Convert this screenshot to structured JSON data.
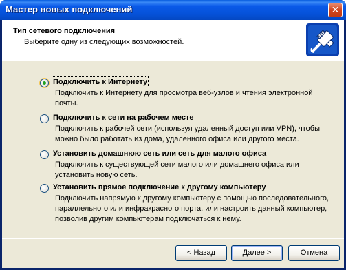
{
  "window": {
    "title": "Мастер новых подключений",
    "close_glyph": "✕"
  },
  "header": {
    "title": "Тип сетевого подключения",
    "subtitle": "Выберите одну из следующих возможностей.",
    "icon": "network-cable-icon"
  },
  "options": [
    {
      "label": "Подключить к Интернету",
      "description": "Подключить к Интернету для просмотра веб-узлов и чтения  электронной почты.",
      "checked": true
    },
    {
      "label": "Подключить к сети на рабочем месте",
      "description": "Подключить к рабочей сети (используя удаленный доступ или VPN), чтобы можно было работать из дома, удаленного офиса или другого места.",
      "checked": false
    },
    {
      "label": "Установить домашнюю сеть или сеть для малого офиса",
      "description": "Подключить к существующей сети малого или домашнего офиса или установить новую сеть.",
      "checked": false
    },
    {
      "label": "Установить прямое подключение к другому компьютеру",
      "description": "Подключить напрямую к другому компьютеру с помощью последовательного, параллельного или инфракрасного порта, или настроить данный компьютер, позволив другим  компьютерам подключаться к нему.",
      "checked": false
    }
  ],
  "buttons": {
    "back": "< Назад",
    "next": "Далее >",
    "cancel": "Отмена"
  }
}
